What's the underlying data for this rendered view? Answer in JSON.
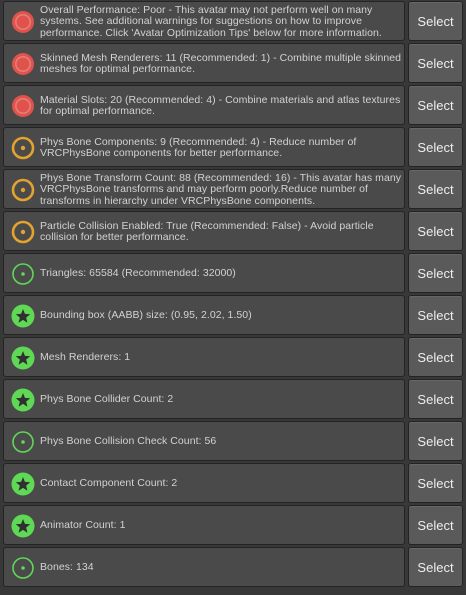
{
  "colors": {
    "poor": "#e0534c",
    "medium": "#e3a32d",
    "good": "#5fd955",
    "excellent": "#5fd955"
  },
  "select_label": "Select",
  "items": [
    {
      "level": "poor",
      "icon": "red-circle-icon",
      "text": "Overall Performance: Poor - This avatar may not perform well on many systems. See additional warnings for suggestions on how to improve performance. Click 'Avatar Optimization Tips' below for more information."
    },
    {
      "level": "poor",
      "icon": "red-circle-icon",
      "text": "Skinned Mesh Renderers: 11 (Recommended: 1) - Combine multiple skinned meshes for optimal performance."
    },
    {
      "level": "poor",
      "icon": "red-circle-icon",
      "text": "Material Slots: 20 (Recommended: 4) - Combine materials and atlas textures for optimal performance."
    },
    {
      "level": "medium",
      "icon": "orange-ring-icon",
      "text": "Phys Bone Components: 9 (Recommended: 4) - Reduce number of VRCPhysBone components for better performance."
    },
    {
      "level": "medium",
      "icon": "orange-ring-icon",
      "text": "Phys Bone Transform Count: 88 (Recommended: 16) - This avatar has many VRCPhysBone transforms and may perform poorly.Reduce number of transforms in hierarchy under VRCPhysBone components."
    },
    {
      "level": "medium",
      "icon": "orange-ring-icon",
      "text": "Particle Collision Enabled: True (Recommended: False) - Avoid particle collision for better performance."
    },
    {
      "level": "good",
      "icon": "green-ring-icon",
      "text": "Triangles: 65584 (Recommended: 32000)"
    },
    {
      "level": "excellent",
      "icon": "green-star-icon",
      "text": "Bounding box (AABB) size: (0.95, 2.02, 1.50)"
    },
    {
      "level": "excellent",
      "icon": "green-star-icon",
      "text": "Mesh Renderers: 1"
    },
    {
      "level": "excellent",
      "icon": "green-star-icon",
      "text": "Phys Bone Collider Count: 2"
    },
    {
      "level": "good",
      "icon": "green-ring-icon",
      "text": "Phys Bone Collision Check Count: 56"
    },
    {
      "level": "excellent",
      "icon": "green-star-icon",
      "text": "Contact Component Count: 2"
    },
    {
      "level": "excellent",
      "icon": "green-star-icon",
      "text": "Animator Count: 1"
    },
    {
      "level": "good",
      "icon": "green-ring-icon",
      "text": "Bones: 134"
    }
  ]
}
